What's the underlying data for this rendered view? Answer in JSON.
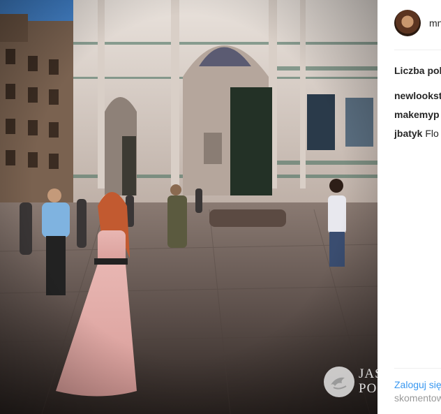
{
  "post": {
    "username": "mn",
    "likes_text": "Liczba pol",
    "comments": [
      {
        "user": "newlookst",
        "text": ""
      },
      {
        "user": "makemyp",
        "text": ""
      },
      {
        "user": "jbatyk",
        "text": "Flo"
      }
    ],
    "login_link": "Zaloguj się",
    "login_suffix": "skomentow"
  },
  "watermark": {
    "line1": "JAS",
    "line2": "PO"
  },
  "colors": {
    "link": "#3897f0",
    "text": "#262626",
    "muted": "#999999",
    "divider": "#efefef"
  },
  "icons": {
    "watermark_logo": "bird-logo-icon",
    "avatar": "user-avatar"
  }
}
